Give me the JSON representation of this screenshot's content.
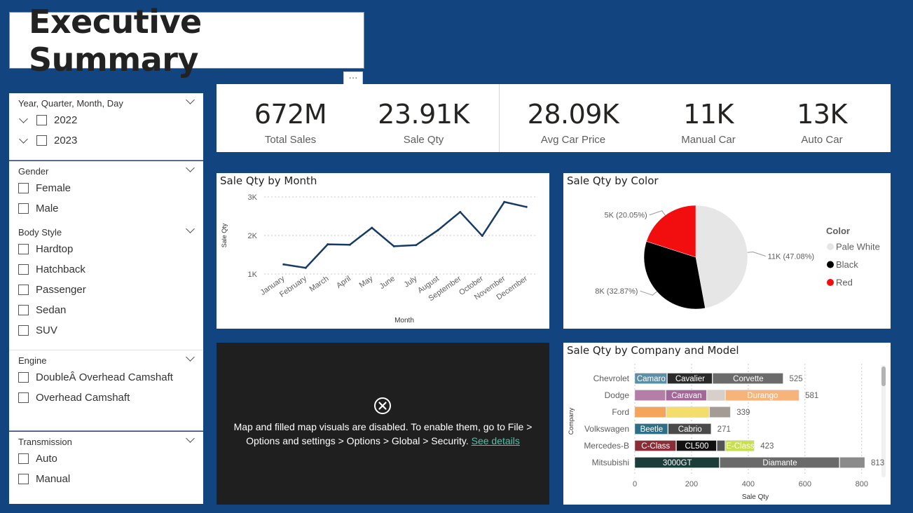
{
  "page": {
    "title": "Executive Summary",
    "more_label": "···"
  },
  "slicers": {
    "date": {
      "header": "Year, Quarter, Month, Day",
      "options": [
        "2022",
        "2023"
      ]
    },
    "gender": {
      "header": "Gender",
      "options": [
        "Female",
        "Male"
      ]
    },
    "body_style": {
      "header": "Body Style",
      "options": [
        "Hardtop",
        "Hatchback",
        "Passenger",
        "Sedan",
        "SUV"
      ]
    },
    "engine": {
      "header": "Engine",
      "options": [
        "DoubleÂ Overhead Camshaft",
        "Overhead Camshaft"
      ]
    },
    "transmission": {
      "header": "Transmission",
      "options": [
        "Auto",
        "Manual"
      ]
    }
  },
  "kpis": [
    {
      "value": "672M",
      "label": "Total Sales"
    },
    {
      "value": "23.91K",
      "label": "Sale Qty"
    },
    {
      "value": "28.09K",
      "label": "Avg Car Price"
    },
    {
      "value": "11K",
      "label": "Manual Car"
    },
    {
      "value": "13K",
      "label": "Auto Car"
    }
  ],
  "map_visual": {
    "message": "Map and filled map visuals are disabled. To enable them, go to File > Options and settings > Options > Global > Security.",
    "link": "See details",
    "icon": "error-circle-icon"
  },
  "chart_data": [
    {
      "type": "line",
      "title": "Sale Qty by Month",
      "xlabel": "Month",
      "ylabel": "Sale Qty",
      "categories": [
        "January",
        "February",
        "March",
        "April",
        "May",
        "June",
        "July",
        "August",
        "September",
        "October",
        "November",
        "December"
      ],
      "values": [
        1250,
        1160,
        1770,
        1760,
        2200,
        1720,
        1750,
        2140,
        2610,
        1990,
        2870,
        2740
      ],
      "ylim": [
        1000,
        3000
      ],
      "yticks": [
        "1K",
        "2K",
        "3K"
      ],
      "grid": true,
      "color": "#173a65"
    },
    {
      "type": "pie",
      "title": "Sale Qty by Color",
      "legend_title": "Color",
      "legend_position": "right",
      "slices": [
        {
          "name": "Pale White",
          "value": 47.08,
          "label": "11K (47.08%)",
          "color": "#e6e6e6"
        },
        {
          "name": "Black",
          "value": 32.87,
          "label": "8K (32.87%)",
          "color": "#000000"
        },
        {
          "name": "Red",
          "value": 20.05,
          "label": "5K (20.05%)",
          "color": "#f20e0e"
        }
      ]
    },
    {
      "type": "bar",
      "orientation": "horizontal",
      "stacked": true,
      "title": "Sale Qty by Company and Model",
      "xlabel": "Sale Qty",
      "ylabel": "Company",
      "xlim": [
        0,
        850
      ],
      "xticks": [
        0,
        200,
        400,
        600,
        800
      ],
      "grid": true,
      "rows": [
        {
          "company": "Chevrolet",
          "total": 525,
          "segments": [
            {
              "model": "Camaro",
              "value": 115,
              "color": "#5b8fa8",
              "text": "#ffffff"
            },
            {
              "model": "Cavalier",
              "value": 160,
              "color": "#2a2a2a",
              "text": "#ffffff"
            },
            {
              "model": "Corvette",
              "value": 250,
              "color": "#6b6b6b",
              "text": "#ffffff"
            }
          ]
        },
        {
          "company": "Dodge",
          "total": 581,
          "segments": [
            {
              "model": "",
              "value": 110,
              "color": "#b37fa8",
              "text": "#ffffff"
            },
            {
              "model": "Caravan",
              "value": 145,
              "color": "#a4679a",
              "text": "#ffffff"
            },
            {
              "model": "",
              "value": 65,
              "color": "#d9cfc9",
              "text": "#ffffff"
            },
            {
              "model": "Durango",
              "value": 261,
              "color": "#f7b47a",
              "text": "#ffffff"
            }
          ]
        },
        {
          "company": "Ford",
          "total": 339,
          "segments": [
            {
              "model": "",
              "value": 112,
              "color": "#f4a55a",
              "text": "#ffffff"
            },
            {
              "model": "",
              "value": 152,
              "color": "#f5dd6b",
              "text": "#ffffff"
            },
            {
              "model": "",
              "value": 75,
              "color": "#a39b94",
              "text": "#ffffff"
            }
          ]
        },
        {
          "company": "Volkswagen",
          "total": 271,
          "segments": [
            {
              "model": "Beetle",
              "value": 118,
              "color": "#2d6f88",
              "text": "#ffffff"
            },
            {
              "model": "Cabrio",
              "value": 153,
              "color": "#4a4a4a",
              "text": "#ffffff"
            }
          ]
        },
        {
          "company": "Mercedes-B",
          "total": 423,
          "segments": [
            {
              "model": "C-Class",
              "value": 147,
              "color": "#8a2d36",
              "text": "#ffffff"
            },
            {
              "model": "CL500",
              "value": 143,
              "color": "#111111",
              "text": "#ffffff"
            },
            {
              "model": "",
              "value": 30,
              "color": "#555555",
              "text": "#ffffff"
            },
            {
              "model": "E-Class",
              "value": 103,
              "color": "#c8e04f",
              "text": "#ffffff"
            }
          ]
        },
        {
          "company": "Mitsubishi",
          "total": 813,
          "segments": [
            {
              "model": "3000GT",
              "value": 300,
              "color": "#1a3d3a",
              "text": "#ffffff"
            },
            {
              "model": "Diamante",
              "value": 423,
              "color": "#6a6a6a",
              "text": "#ffffff"
            },
            {
              "model": "",
              "value": 90,
              "color": "#8b8b8b",
              "text": "#ffffff"
            }
          ]
        }
      ]
    }
  ]
}
